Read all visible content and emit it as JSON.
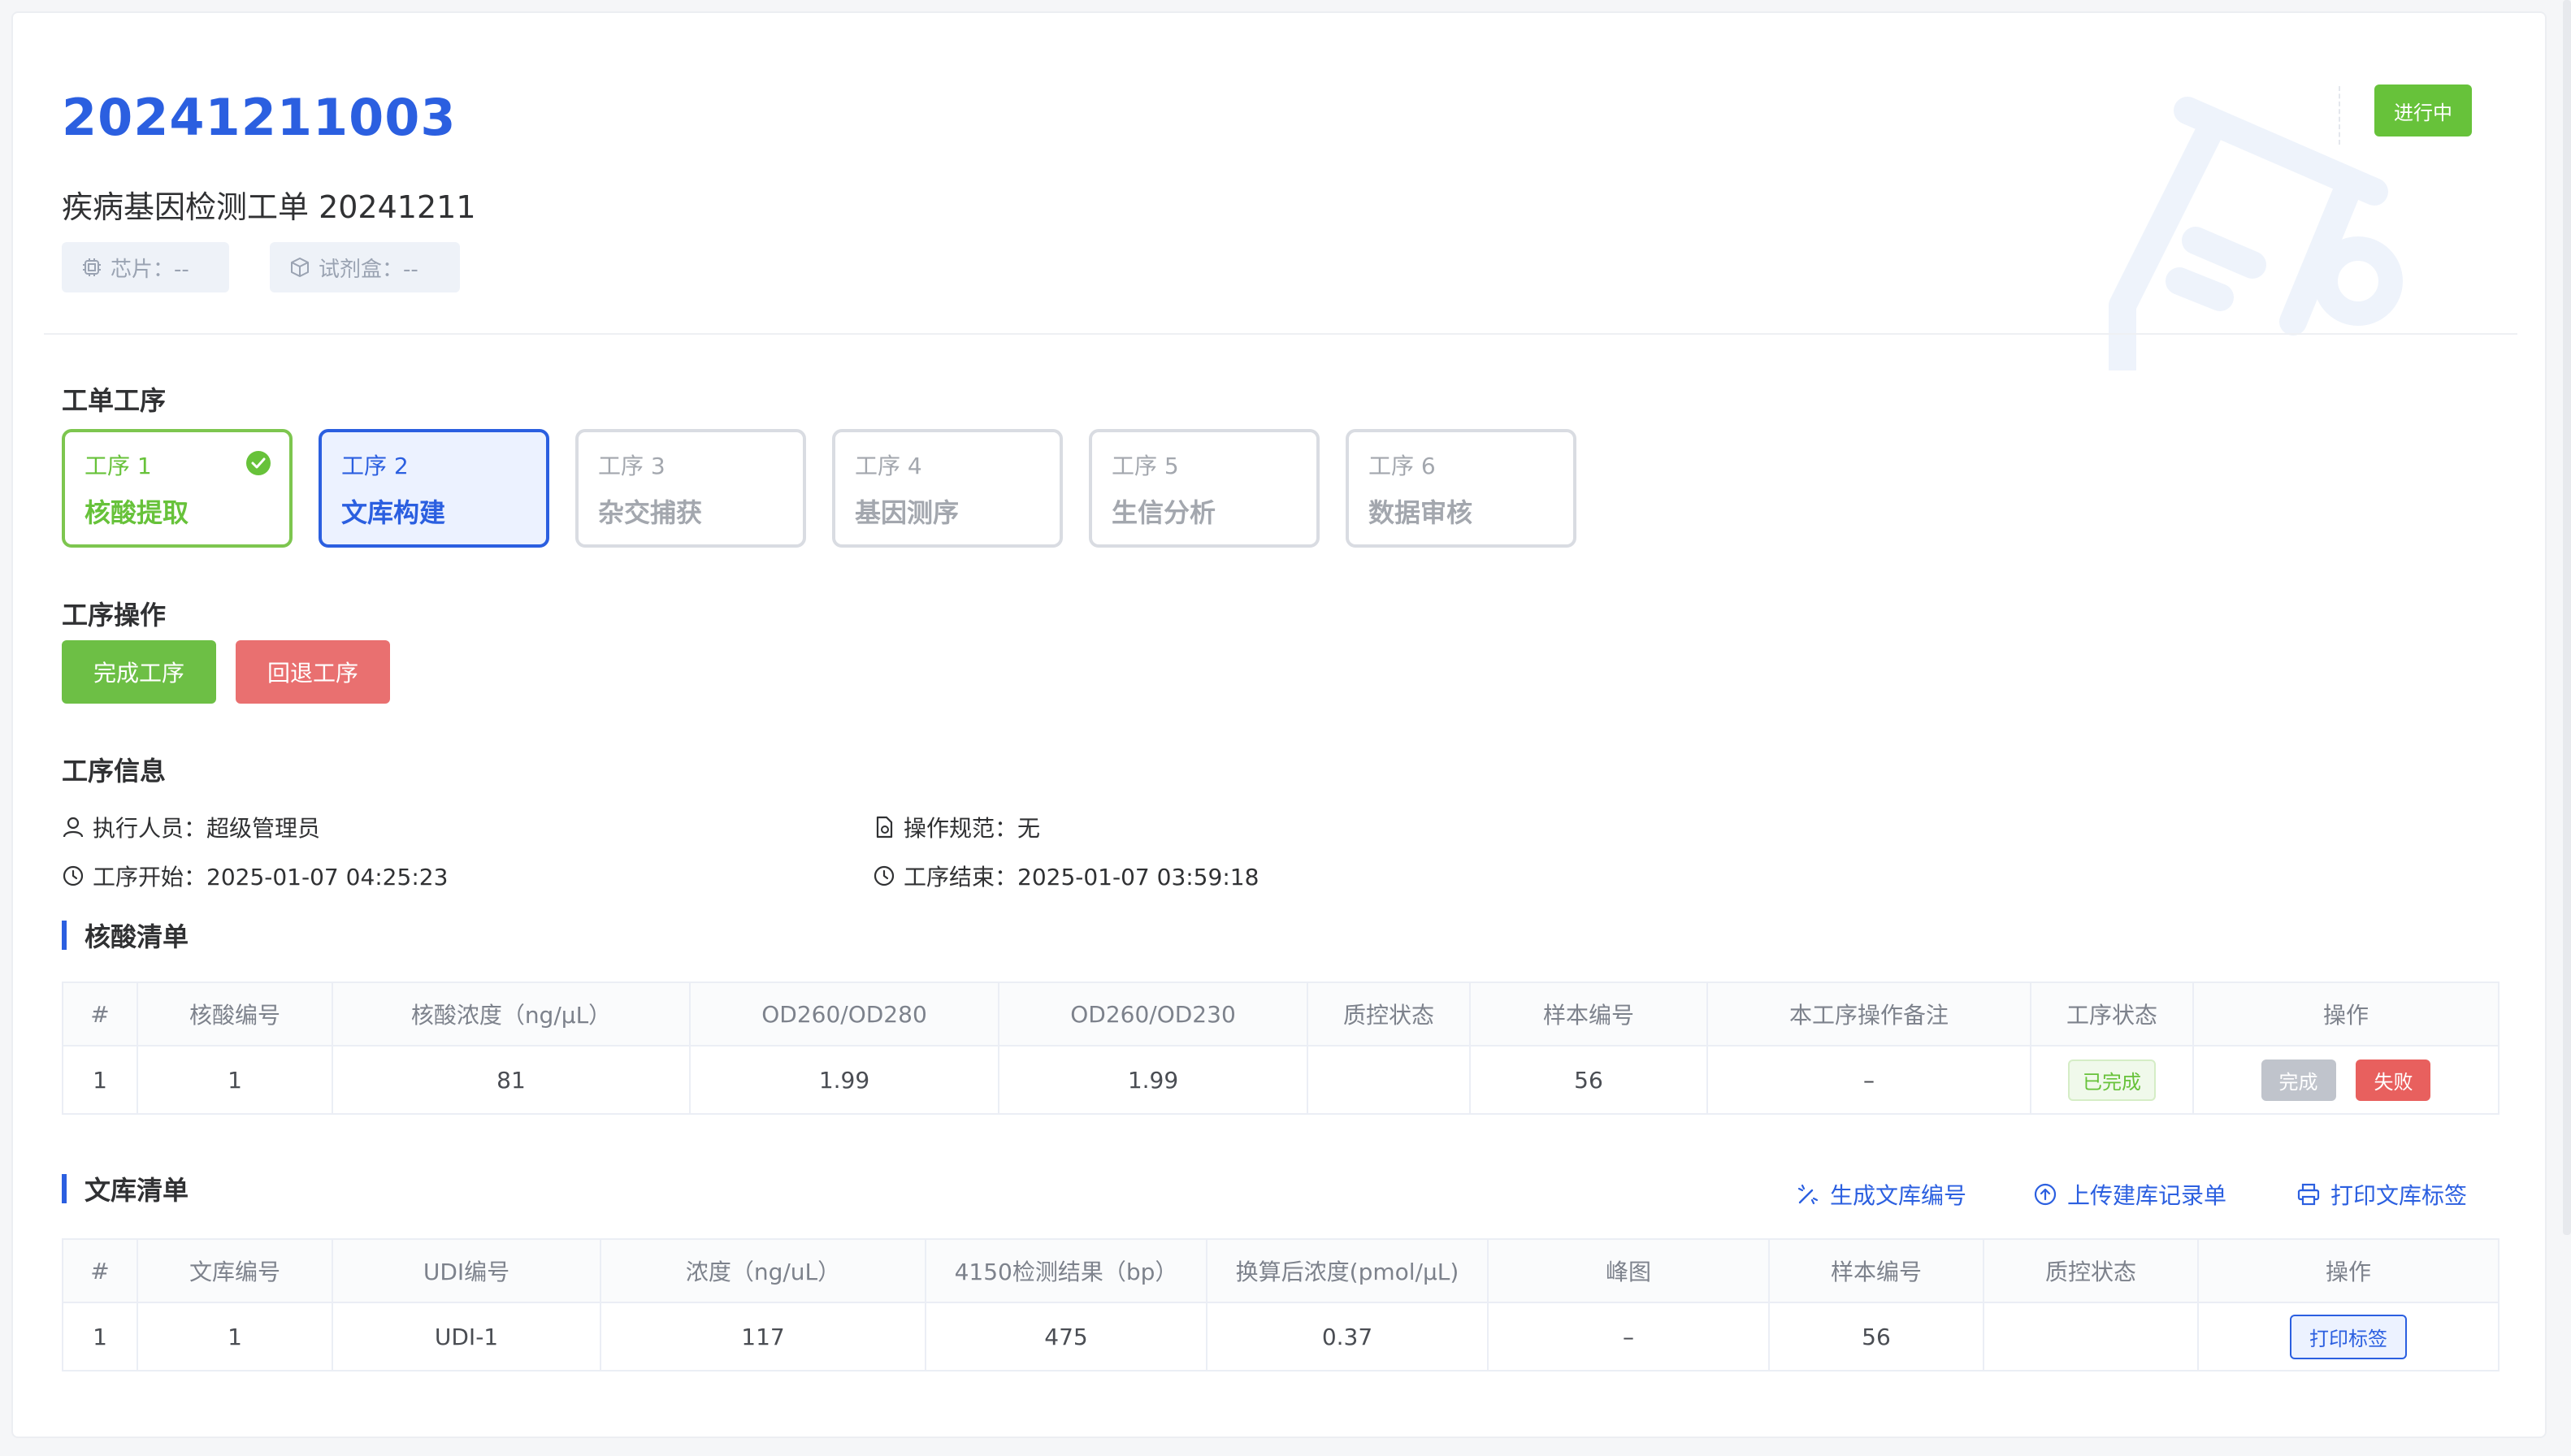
{
  "order": {
    "number": "20241211003",
    "name": "疾病基因检测工单 20241211",
    "status": "进行中",
    "chip_label": "芯片：--",
    "kit_label": "试剂盒：--"
  },
  "sections": {
    "steps_title": "工单工序",
    "ops_title": "工序操作",
    "info_title": "工序信息",
    "nucleic_title": "核酸清单",
    "library_title": "文库清单"
  },
  "steps": [
    {
      "no": "工序 1",
      "name": "核酸提取",
      "state": "done"
    },
    {
      "no": "工序 2",
      "name": "文库构建",
      "state": "active"
    },
    {
      "no": "工序 3",
      "name": "杂交捕获",
      "state": "pending"
    },
    {
      "no": "工序 4",
      "name": "基因测序",
      "state": "pending"
    },
    {
      "no": "工序 5",
      "name": "生信分析",
      "state": "pending"
    },
    {
      "no": "工序 6",
      "name": "数据审核",
      "state": "pending"
    }
  ],
  "ops": {
    "complete_label": "完成工序",
    "rollback_label": "回退工序"
  },
  "info": {
    "operator": "执行人员：超级管理员",
    "spec": "操作规范：无",
    "start": "工序开始：2025-01-07 04:25:23",
    "end": "工序结束：2025-01-07 03:59:18"
  },
  "nucleic_table": {
    "headers": [
      "#",
      "核酸编号",
      "核酸浓度（ng/μL）",
      "OD260/OD280",
      "OD260/OD230",
      "质控状态",
      "样本编号",
      "本工序操作备注",
      "工序状态",
      "操作"
    ],
    "rows": [
      {
        "idx": "1",
        "code": "1",
        "conc": "81",
        "od280": "1.99",
        "od230": "1.99",
        "qc": "",
        "sample": "56",
        "remark": "–",
        "status": "已完成",
        "btn_done": "完成",
        "btn_fail": "失败"
      }
    ]
  },
  "library_actions": {
    "generate": "生成文库编号",
    "upload": "上传建库记录单",
    "print": "打印文库标签"
  },
  "library_table": {
    "headers": [
      "#",
      "文库编号",
      "UDI编号",
      "浓度（ng/uL）",
      "4150检测结果（bp）",
      "换算后浓度(pmol/μL)",
      "峰图",
      "样本编号",
      "质控状态",
      "操作"
    ],
    "rows": [
      {
        "idx": "1",
        "code": "1",
        "udi": "UDI-1",
        "conc": "117",
        "bp": "475",
        "pmol": "0.37",
        "peak": "–",
        "sample": "56",
        "qc": "",
        "btn_print": "打印标签"
      }
    ]
  },
  "colors": {
    "primary": "#2b5fe0",
    "success": "#67c23a",
    "danger": "#e97070"
  }
}
